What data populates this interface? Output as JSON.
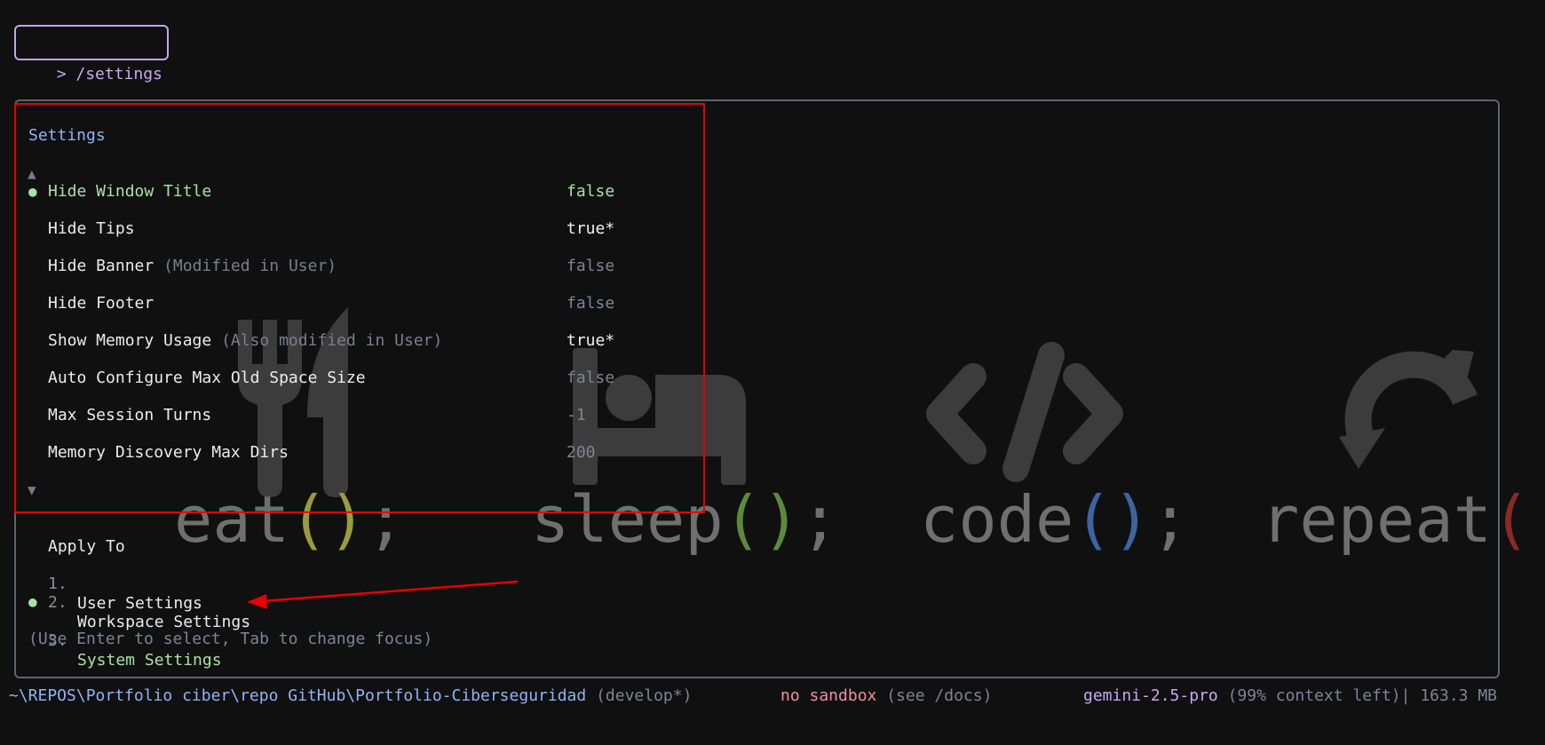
{
  "command": {
    "text": "> /settings"
  },
  "wallpaper": {
    "segments": [
      {
        "word": "eat",
        "paren_color": "#9c9a3c"
      },
      {
        "word": "sleep",
        "paren_color": "#5d8a3a"
      },
      {
        "word": "code",
        "paren_color": "#3e63a0"
      },
      {
        "word": "repeat",
        "paren_color": "#8a2a24"
      }
    ],
    "open_paren": "(",
    "close_paren": ")",
    "semicolon": ";",
    "icons": [
      "fork-knife-icon",
      "bed-icon",
      "code-brackets-icon",
      "refresh-icon"
    ]
  },
  "settings": {
    "title": "Settings",
    "scroll_up": "▲",
    "scroll_down": "▼",
    "bullet": "●",
    "items": [
      {
        "label": "Hide Window Title",
        "note": "",
        "value": "false",
        "active": true
      },
      {
        "label": "Hide Tips",
        "note": "",
        "value": "true*",
        "active": false
      },
      {
        "label": "Hide Banner",
        "note": "(Modified in User)",
        "value": "false",
        "active": false
      },
      {
        "label": "Hide Footer",
        "note": "",
        "value": "false",
        "active": false
      },
      {
        "label": "Show Memory Usage",
        "note": "(Also modified in User)",
        "value": "true*",
        "active": false
      },
      {
        "label": "Auto Configure Max Old Space Size",
        "note": "",
        "value": "false",
        "active": false
      },
      {
        "label": "Max Session Turns",
        "note": "",
        "value": "-1",
        "active": false
      },
      {
        "label": "Memory Discovery Max Dirs",
        "note": "",
        "value": "200",
        "active": false
      }
    ]
  },
  "apply_to": {
    "title": "Apply To",
    "options": [
      {
        "number": "1.",
        "label": "User Settings",
        "selected": false
      },
      {
        "number": "2.",
        "label": "Workspace Settings",
        "selected": false
      },
      {
        "number": "3.",
        "label": "System Settings",
        "selected": true
      }
    ]
  },
  "help_text": "(Use Enter to select, Tab to change focus)",
  "status_bar": {
    "path": "~\\REPOS\\Portfolio ciber\\repo GitHub\\Portfolio-Ciberseguridad",
    "branch": "(develop*)",
    "sandbox": "no sandbox",
    "sandbox_hint": "(see /docs)",
    "model": "gemini-2.5-pro",
    "context": "(99% context left)|",
    "memory": "163.3 MB"
  },
  "colors": {
    "background": "#101010",
    "accent_green": "#a6e3a1",
    "accent_blue": "#8fb5f5",
    "accent_purple": "#cba6f7",
    "accent_pink": "#f38ba8",
    "highlight_red": "#e60000"
  }
}
